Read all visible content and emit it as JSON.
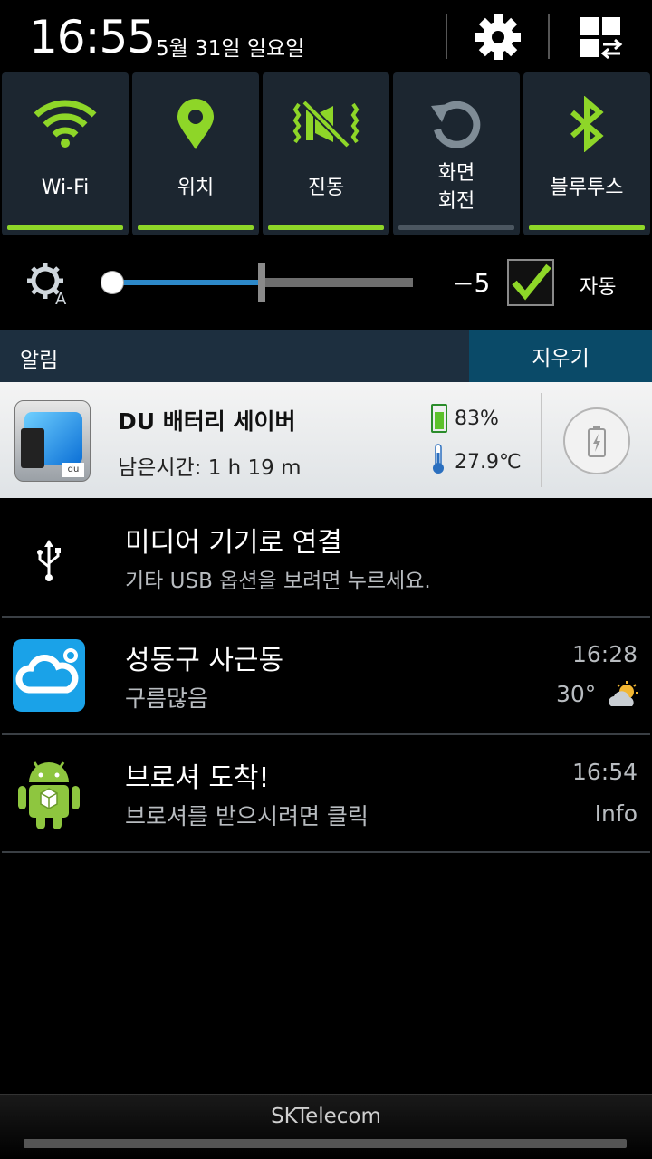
{
  "status": {
    "time": "16:55",
    "date": "5월 31일 일요일"
  },
  "header_icons": [
    "settings-gear-icon",
    "grid-swap-icon"
  ],
  "quick_settings": [
    {
      "label": "Wi-Fi",
      "icon": "wifi-icon",
      "active": true
    },
    {
      "label": "위치",
      "icon": "location-pin-icon",
      "active": true
    },
    {
      "label": "진동",
      "icon": "vibrate-icon",
      "active": true
    },
    {
      "label": "화면\n회전",
      "icon": "rotate-icon",
      "active": false
    },
    {
      "label": "블루투스",
      "icon": "bluetooth-icon",
      "active": true
    }
  ],
  "brightness": {
    "value": "−5",
    "auto_label": "자동",
    "auto_checked": true,
    "level": 0.49
  },
  "notifications_header": {
    "title": "알림",
    "clear_label": "지우기"
  },
  "du_battery": {
    "title": "DU 배터리 세이버",
    "remaining": "남은시간: 1 h 19 m",
    "battery": "83%",
    "temperature": "27.9℃",
    "icon_text": "du"
  },
  "notifications": [
    {
      "title": "미디어 기기로 연결",
      "subtitle": "기타 USB 옵션을 보려면 누르세요.",
      "icon": "usb-icon"
    },
    {
      "title": "성동구 사근동",
      "subtitle": "구름많음",
      "time": "16:28",
      "extra": "30°",
      "icon": "weather-cloud-icon"
    },
    {
      "title": "브로셔 도착!",
      "subtitle": "브로셔를 받으시려면 클릭",
      "time": "16:54",
      "extra": "Info",
      "icon": "android-icon"
    }
  ],
  "carrier": "SKTelecom",
  "colors": {
    "accent_green": "#8ed628",
    "tile_bg": "#1c2630",
    "slider_blue": "#2d89c9"
  }
}
